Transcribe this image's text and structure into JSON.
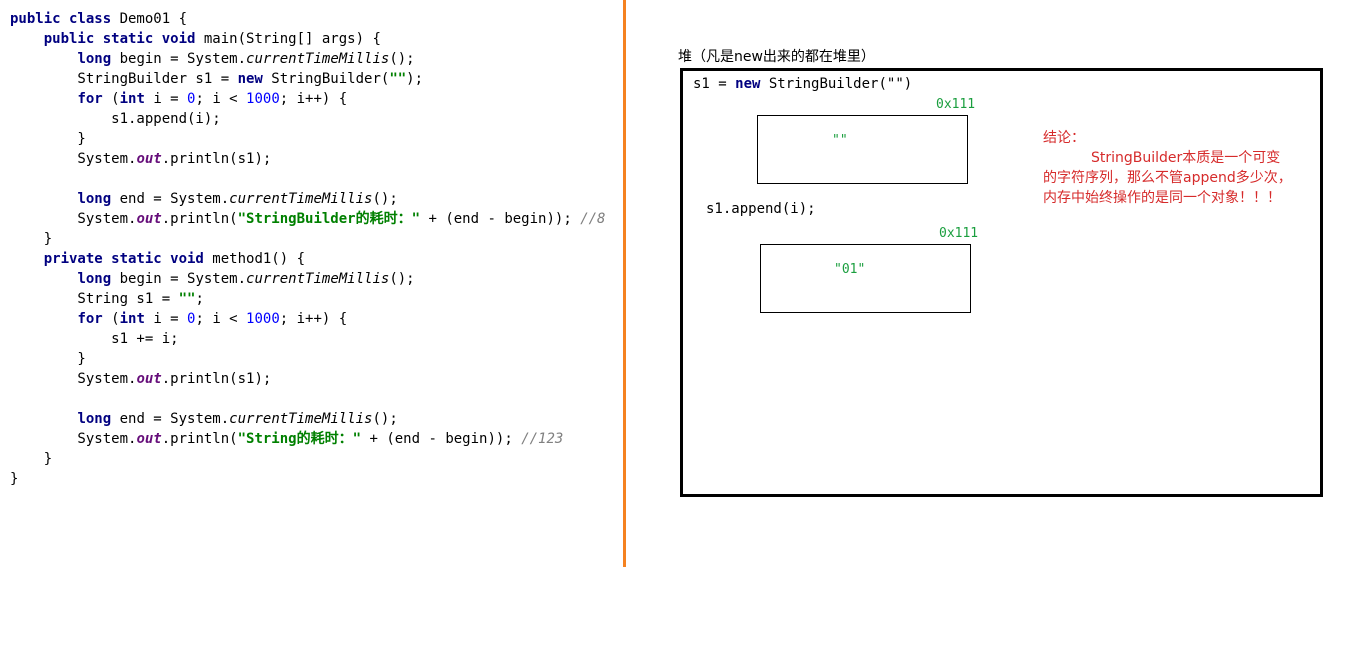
{
  "code": {
    "lines": [
      [
        {
          "t": "public class ",
          "c": "kw"
        },
        {
          "t": "Demo01 {",
          "c": ""
        }
      ],
      [
        {
          "t": "    ",
          "c": ""
        },
        {
          "t": "public static void ",
          "c": "kw"
        },
        {
          "t": "main(String[] args) {",
          "c": ""
        }
      ],
      [
        {
          "t": "        ",
          "c": ""
        },
        {
          "t": "long ",
          "c": "kw"
        },
        {
          "t": "begin = System.",
          "c": ""
        },
        {
          "t": "currentTimeMillis",
          "c": "ital"
        },
        {
          "t": "();",
          "c": ""
        }
      ],
      [
        {
          "t": "        StringBuilder s1 = ",
          "c": ""
        },
        {
          "t": "new ",
          "c": "kw"
        },
        {
          "t": "StringBuilder(",
          "c": ""
        },
        {
          "t": "\"\"",
          "c": "str"
        },
        {
          "t": ");",
          "c": ""
        }
      ],
      [
        {
          "t": "        ",
          "c": ""
        },
        {
          "t": "for ",
          "c": "kw"
        },
        {
          "t": "(",
          "c": ""
        },
        {
          "t": "int ",
          "c": "kw"
        },
        {
          "t": "i = ",
          "c": ""
        },
        {
          "t": "0",
          "c": "num"
        },
        {
          "t": "; i < ",
          "c": ""
        },
        {
          "t": "1000",
          "c": "num"
        },
        {
          "t": "; i++) {",
          "c": ""
        }
      ],
      [
        {
          "t": "            s1.append(i);",
          "c": ""
        }
      ],
      [
        {
          "t": "        }",
          "c": ""
        }
      ],
      [
        {
          "t": "        System.",
          "c": ""
        },
        {
          "t": "out",
          "c": "fld"
        },
        {
          "t": ".println(s1);",
          "c": ""
        }
      ],
      [
        {
          "t": "",
          "c": ""
        }
      ],
      [
        {
          "t": "        ",
          "c": ""
        },
        {
          "t": "long ",
          "c": "kw"
        },
        {
          "t": "end = System.",
          "c": ""
        },
        {
          "t": "currentTimeMillis",
          "c": "ital"
        },
        {
          "t": "();",
          "c": ""
        }
      ],
      [
        {
          "t": "        System.",
          "c": ""
        },
        {
          "t": "out",
          "c": "fld"
        },
        {
          "t": ".println(",
          "c": ""
        },
        {
          "t": "\"StringBuilder的耗时：\"",
          "c": "str"
        },
        {
          "t": " + (end - begin)); ",
          "c": ""
        },
        {
          "t": "//8",
          "c": "cmt"
        }
      ],
      [
        {
          "t": "    }",
          "c": ""
        }
      ],
      [
        {
          "t": "    ",
          "c": ""
        },
        {
          "t": "private static void ",
          "c": "kw"
        },
        {
          "t": "method1() {",
          "c": ""
        }
      ],
      [
        {
          "t": "        ",
          "c": ""
        },
        {
          "t": "long ",
          "c": "kw"
        },
        {
          "t": "begin = System.",
          "c": ""
        },
        {
          "t": "currentTimeMillis",
          "c": "ital"
        },
        {
          "t": "();",
          "c": ""
        }
      ],
      [
        {
          "t": "        String s1 = ",
          "c": ""
        },
        {
          "t": "\"\"",
          "c": "str"
        },
        {
          "t": ";",
          "c": ""
        }
      ],
      [
        {
          "t": "        ",
          "c": ""
        },
        {
          "t": "for ",
          "c": "kw"
        },
        {
          "t": "(",
          "c": ""
        },
        {
          "t": "int ",
          "c": "kw"
        },
        {
          "t": "i = ",
          "c": ""
        },
        {
          "t": "0",
          "c": "num"
        },
        {
          "t": "; i < ",
          "c": ""
        },
        {
          "t": "1000",
          "c": "num"
        },
        {
          "t": "; i++) {",
          "c": ""
        }
      ],
      [
        {
          "t": "            s1 += i;",
          "c": ""
        }
      ],
      [
        {
          "t": "        }",
          "c": ""
        }
      ],
      [
        {
          "t": "        System.",
          "c": ""
        },
        {
          "t": "out",
          "c": "fld"
        },
        {
          "t": ".println(s1);",
          "c": ""
        }
      ],
      [
        {
          "t": "",
          "c": ""
        }
      ],
      [
        {
          "t": "        ",
          "c": ""
        },
        {
          "t": "long ",
          "c": "kw"
        },
        {
          "t": "end = System.",
          "c": ""
        },
        {
          "t": "currentTimeMillis",
          "c": "ital"
        },
        {
          "t": "();",
          "c": ""
        }
      ],
      [
        {
          "t": "        System.",
          "c": ""
        },
        {
          "t": "out",
          "c": "fld"
        },
        {
          "t": ".println(",
          "c": ""
        },
        {
          "t": "\"String的耗时：\"",
          "c": "str"
        },
        {
          "t": " + (end - begin)); ",
          "c": ""
        },
        {
          "t": "//123",
          "c": "cmt"
        }
      ],
      [
        {
          "t": "    }",
          "c": ""
        }
      ],
      [
        {
          "t": "}",
          "c": ""
        }
      ]
    ]
  },
  "heap": {
    "title": "堆（凡是new出来的都在堆里）",
    "decl_prefix": "s1 = ",
    "decl_kw": "new",
    "decl_suffix": " StringBuilder(\"\")",
    "obj1": {
      "address": "0x111",
      "value": "\"\""
    },
    "append_label": "s1.append(i);",
    "obj2": {
      "address": "0x111",
      "value": "\"01\""
    }
  },
  "conclusion": {
    "heading": "结论：",
    "body": "StringBuilder本质是一个可变的字符序列，那么不管append多少次，内存中始终操作的是同一个对象！！！"
  },
  "colors": {
    "divider": "#f58220",
    "address": "#1a9e3e",
    "conclusion": "#d62b2b",
    "keyword": "#000080",
    "string": "#008000"
  }
}
